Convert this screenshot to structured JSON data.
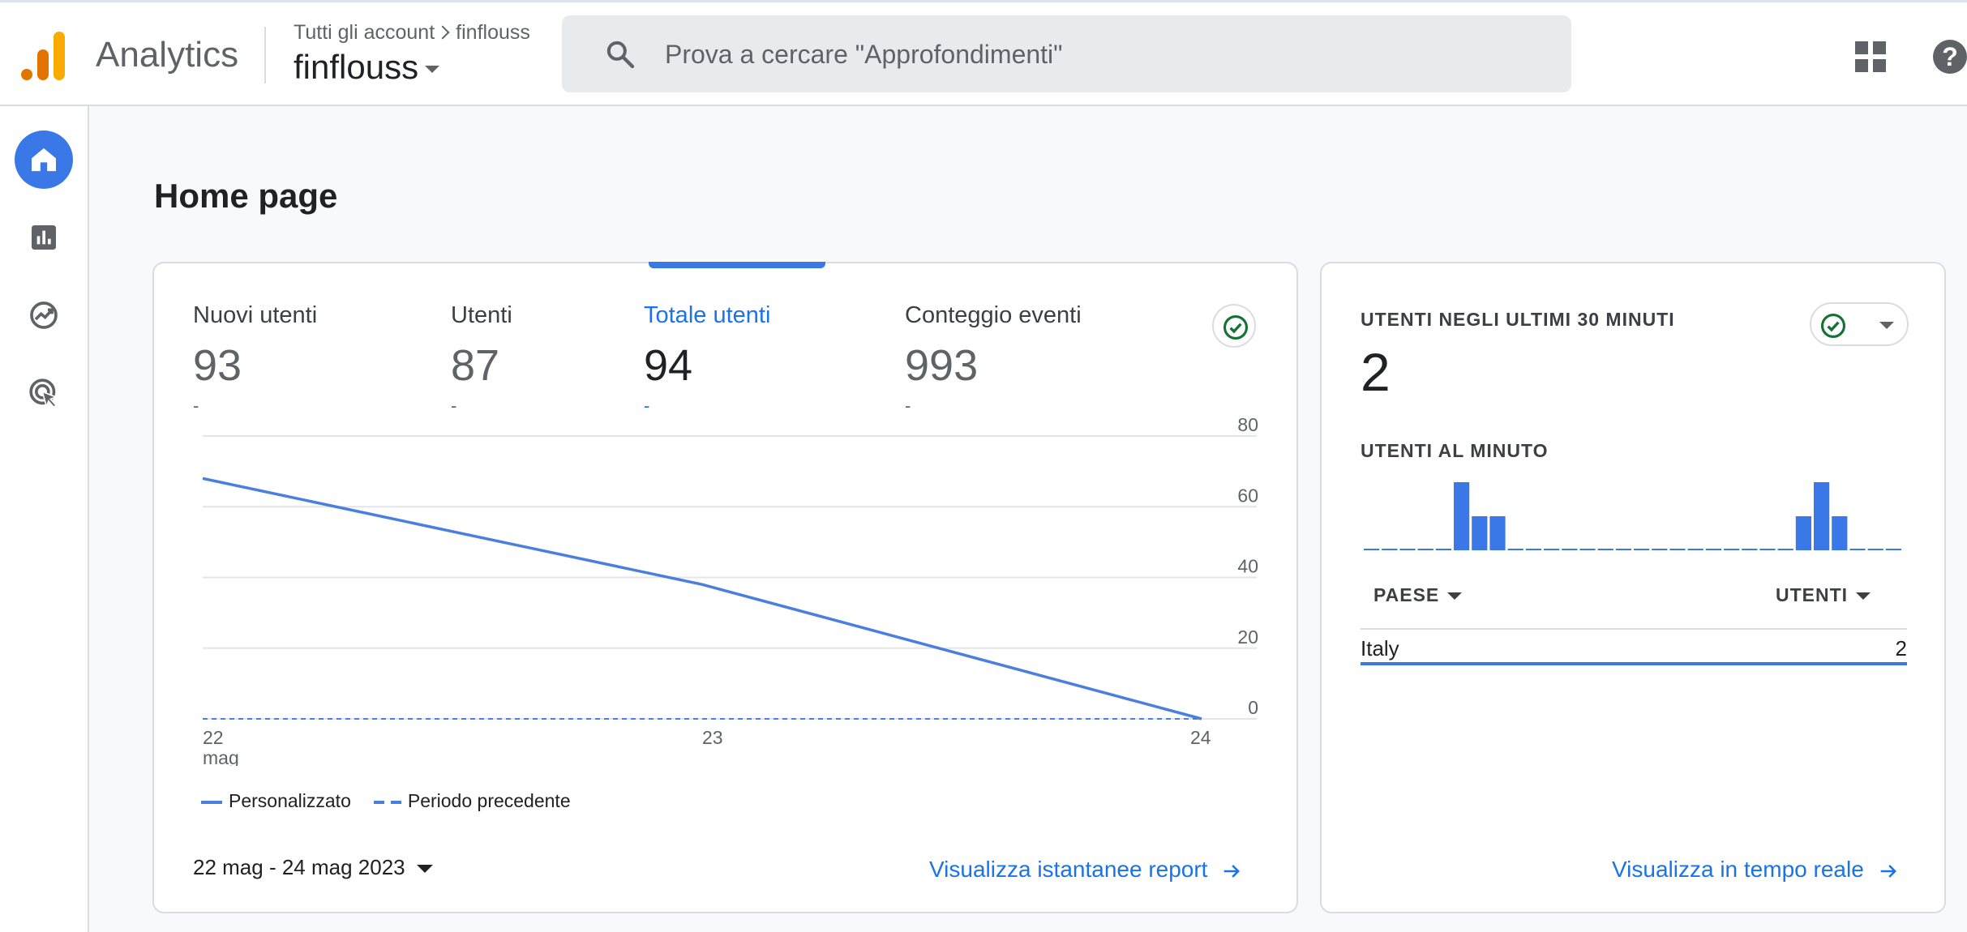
{
  "header": {
    "app_title": "Analytics",
    "breadcrumb": {
      "root": "Tutti gli account",
      "account": "finflouss"
    },
    "property_name": "finflouss",
    "search_placeholder": "Prova a cercare \"Approfondimenti\"",
    "help_label": "?"
  },
  "sidenav": {
    "items": [
      {
        "name": "home",
        "active": true
      },
      {
        "name": "reports",
        "active": false
      },
      {
        "name": "explore",
        "active": false
      },
      {
        "name": "advertising",
        "active": false
      }
    ]
  },
  "page": {
    "title": "Home page"
  },
  "overview": {
    "metrics": [
      {
        "label": "Nuovi utenti",
        "value": "93",
        "delta": "-"
      },
      {
        "label": "Utenti",
        "value": "87",
        "delta": "-"
      },
      {
        "label": "Totale utenti",
        "value": "94",
        "delta": "-",
        "active": true
      },
      {
        "label": "Conteggio eventi",
        "value": "993",
        "delta": "-"
      }
    ],
    "legend": {
      "current": "Personalizzato",
      "previous": "Periodo precedente"
    },
    "date_range": "22 mag - 24 mag 2023",
    "report_link": "Visualizza istantanee report"
  },
  "chart_data": {
    "type": "line",
    "x": [
      "22",
      "23",
      "24"
    ],
    "x_month_label": "mag",
    "ylim": [
      0,
      80
    ],
    "y_ticks": [
      "0",
      "20",
      "40",
      "60",
      "80"
    ],
    "grid": true,
    "legend_position": "bottom-left",
    "series": [
      {
        "name": "Personalizzato",
        "values": [
          68,
          38,
          0
        ],
        "style": "solid",
        "color": "#4a7fe0"
      },
      {
        "name": "Periodo precedente",
        "values": [
          0,
          0,
          0
        ],
        "style": "dashed",
        "color": "#4a7fe0"
      }
    ]
  },
  "realtime": {
    "title": "UTENTI NEGLI ULTIMI 30 MINUTI",
    "value": "2",
    "per_minute_title": "UTENTI AL MINUTO",
    "per_minute": [
      0,
      0,
      0,
      0,
      0,
      2,
      1,
      1,
      0,
      0,
      0,
      0,
      0,
      0,
      0,
      0,
      0,
      0,
      0,
      0,
      0,
      0,
      0,
      0,
      1,
      2,
      1,
      0,
      0,
      0
    ],
    "bar_color": "#3b78e7",
    "table": {
      "col_country": "PAESE",
      "col_users": "UTENTI",
      "rows": [
        {
          "country": "Italy",
          "users": "2"
        }
      ]
    },
    "link": "Visualizza in tempo reale"
  }
}
